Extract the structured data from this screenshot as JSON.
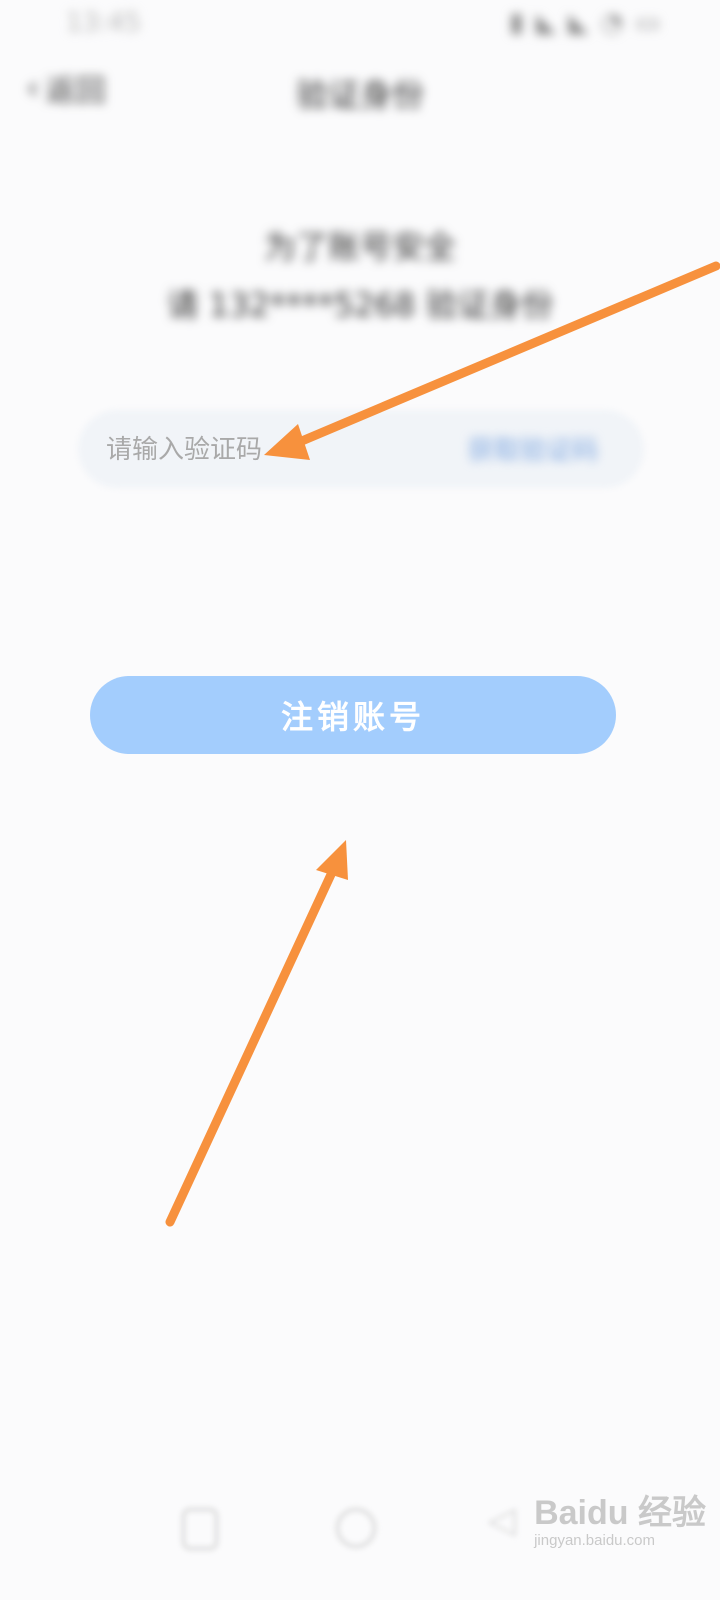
{
  "status_bar": {
    "time": "13:45",
    "icons": "▮ ◣ ◣ ◔ ▭"
  },
  "header": {
    "back_label": "返回",
    "title": "验证身份"
  },
  "tip": {
    "line1": "为了账号安全",
    "line2": "请 132****5268 验证身份"
  },
  "code_input": {
    "value": "",
    "placeholder": "请输入验证码"
  },
  "get_code_label": "获取验证码",
  "cancel_button_label": "注销账号",
  "watermark": {
    "top": "Baidu 经验",
    "bottom": "jingyan.baidu.com"
  },
  "colors": {
    "arrow": "#f7913d",
    "button": "#a3cdfd",
    "link": "#7ea7e0"
  }
}
